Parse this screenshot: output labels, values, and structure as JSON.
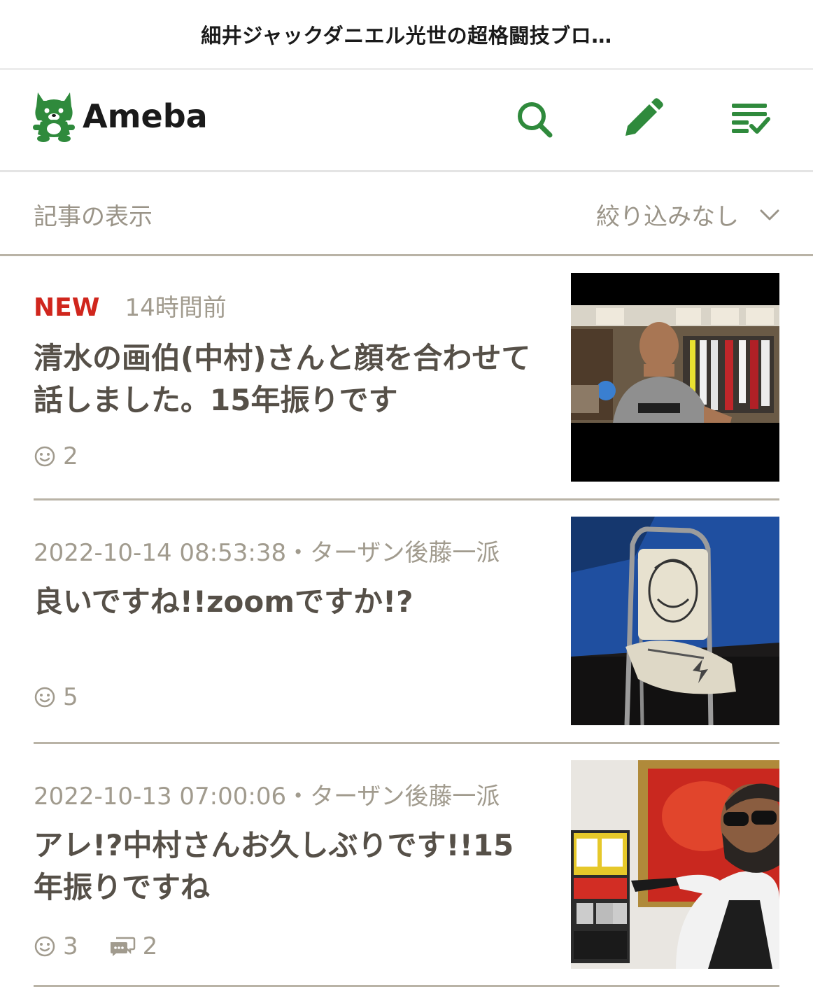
{
  "window": {
    "title": "細井ジャックダニエル光世の超格闘技ブロ…"
  },
  "header": {
    "logo_text": "Ameba",
    "brand_color": "#2f8a3c",
    "icons": [
      "search-icon",
      "pencil-icon",
      "checklist-icon"
    ]
  },
  "filter": {
    "label": "記事の表示",
    "value": "絞り込みなし"
  },
  "entries": [
    {
      "badge": "NEW",
      "time": "14時間前",
      "title": "清水の画伯(中村)さんと顔を合わせて話しました。15年振りです",
      "likes": "2",
      "thumbnail": "photo-man-in-gray-tshirt"
    },
    {
      "date": "2022-10-14 08:53:38",
      "separator": "・",
      "category": "ターザン後藤一派",
      "title": "良いですね!!zoomですか!?",
      "likes": "5",
      "thumbnail": "photo-drawing-on-chair"
    },
    {
      "date": "2022-10-13 07:00:06",
      "separator": "・",
      "category": "ターザン後藤一派",
      "title": "アレ!?中村さんお久しぶりです!!15年振りですね",
      "likes": "3",
      "comments": "2",
      "thumbnail": "photo-wrestler-sunglasses"
    }
  ],
  "colors": {
    "new": "#d0261d",
    "meta": "#a19b8e",
    "title": "#565048",
    "divider": "#b9b3a6"
  }
}
